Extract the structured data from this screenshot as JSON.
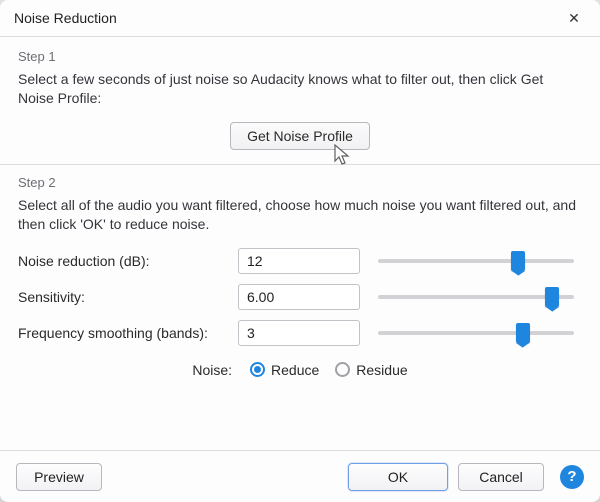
{
  "window": {
    "title": "Noise Reduction",
    "close_glyph": "✕"
  },
  "step1": {
    "heading": "Step 1",
    "body": "Select a few seconds of just noise so Audacity knows what to filter out, then click Get Noise Profile:",
    "profile_button": "Get Noise Profile"
  },
  "step2": {
    "heading": "Step 2",
    "body": "Select all of the audio you want filtered, choose how much noise you want filtered out, and then click 'OK' to reduce noise."
  },
  "params": {
    "noise_reduction": {
      "label": "Noise reduction (dB):",
      "value": "12",
      "pos_pct": 70
    },
    "sensitivity": {
      "label": "Sensitivity:",
      "value": "6.00",
      "pos_pct": 86
    },
    "smoothing": {
      "label": "Frequency smoothing (bands):",
      "value": "3",
      "pos_pct": 72
    }
  },
  "noise_mode": {
    "label": "Noise:",
    "reduce": "Reduce",
    "residue": "Residue",
    "selected": "reduce"
  },
  "footer": {
    "preview": "Preview",
    "ok": "OK",
    "cancel": "Cancel",
    "help": "?"
  }
}
